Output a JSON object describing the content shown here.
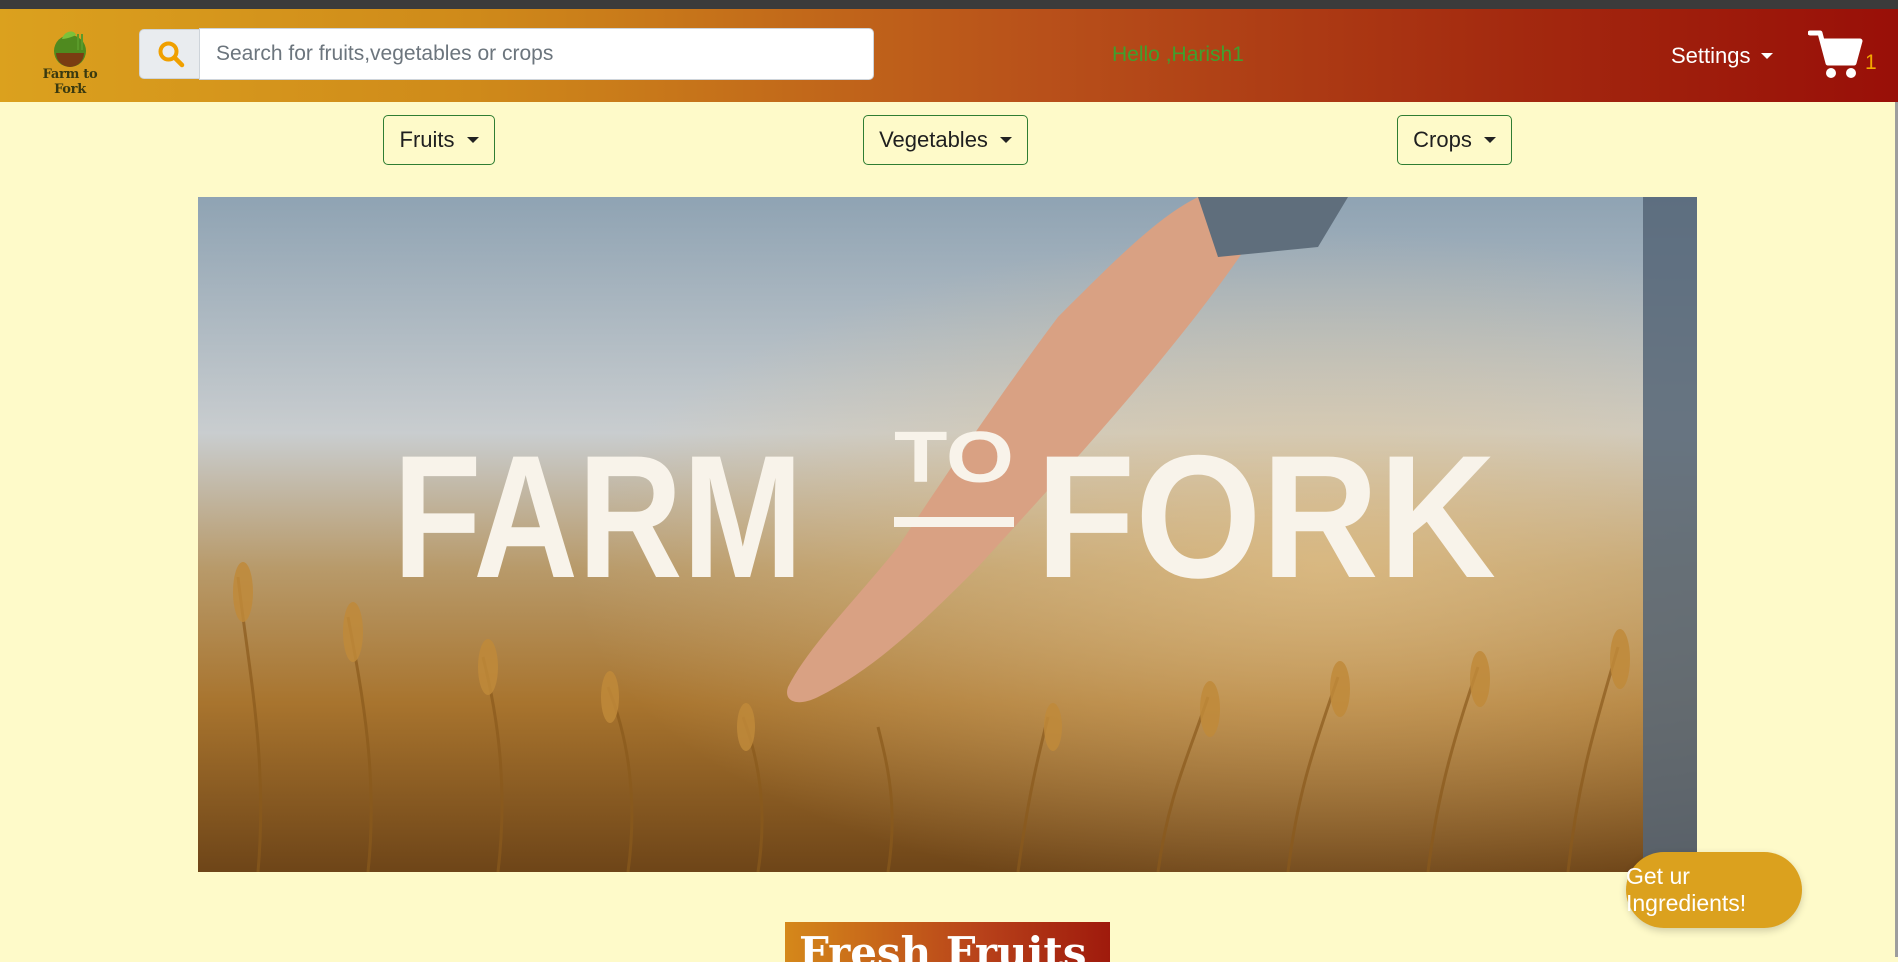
{
  "colors": {
    "accent": "#dba11e",
    "greeting": "#3fa02e",
    "cart_count": "#f5a800",
    "page_bg": "#fefac9"
  },
  "header": {
    "logo_text": "Farm to Fork",
    "search_placeholder": "Search for fruits,vegetables or crops",
    "search_icon": "search-icon",
    "greeting": "Hello ,Harish1",
    "settings_label": "Settings",
    "cart_icon": "cart-icon",
    "cart_count": "1"
  },
  "categories": [
    {
      "label": "Fruits"
    },
    {
      "label": "Vegetables"
    },
    {
      "label": "Crops"
    }
  ],
  "hero": {
    "title_left": "FARM",
    "title_mid": "TO",
    "title_right": "FORK"
  },
  "section": {
    "title": "Fresh Fruits"
  },
  "cta": {
    "label": "Get ur Ingredients!"
  }
}
